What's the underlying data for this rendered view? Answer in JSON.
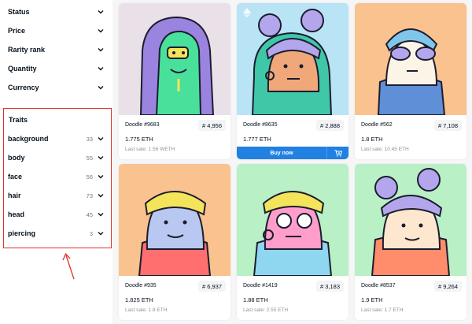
{
  "sidebar": {
    "filters": [
      {
        "label": "Status"
      },
      {
        "label": "Price"
      },
      {
        "label": "Rarity rank"
      },
      {
        "label": "Quantity"
      },
      {
        "label": "Currency"
      }
    ],
    "traits_title": "Traits",
    "traits": [
      {
        "label": "background",
        "count": "33"
      },
      {
        "label": "body",
        "count": "55"
      },
      {
        "label": "face",
        "count": "56"
      },
      {
        "label": "hair",
        "count": "73"
      },
      {
        "label": "head",
        "count": "45"
      },
      {
        "label": "piercing",
        "count": "3"
      }
    ],
    "highlight_color": "#e0342b"
  },
  "cards": [
    {
      "name": "Doodle #9683",
      "rank": "# 4,956",
      "price": "1.775 ETH",
      "last_sale": "Last sale: 1.56 WETH",
      "bg": "#eae1e8"
    },
    {
      "name": "Doodle #8635",
      "rank": "# 2,888",
      "price": "1.777 ETH",
      "last_sale": "",
      "bg": "#b8e4f5",
      "buy_label": "Buy now",
      "cart_icon": "cart-icon",
      "has_eth_badge": true
    },
    {
      "name": "Doodle #562",
      "rank": "# 7,108",
      "price": "1.8 ETH",
      "last_sale": "Last sale: 10.45 ETH",
      "bg": "#f9c28e"
    },
    {
      "name": "Doodle #935",
      "rank": "# 6,937",
      "price": "1.825 ETH",
      "last_sale": "Last sale: 1.8 ETH",
      "bg": "#f9c28e"
    },
    {
      "name": "Doodle #1419",
      "rank": "# 3,183",
      "price": "1.88 ETH",
      "last_sale": "Last sale: 2.55 ETH",
      "bg": "#b9f0c6"
    },
    {
      "name": "Doodle #8537",
      "rank": "# 9,264",
      "price": "1.9 ETH",
      "last_sale": "Last sale: 1.7 ETH",
      "bg": "#b9f0c6"
    }
  ],
  "colors": {
    "accent": "#2081e2"
  }
}
